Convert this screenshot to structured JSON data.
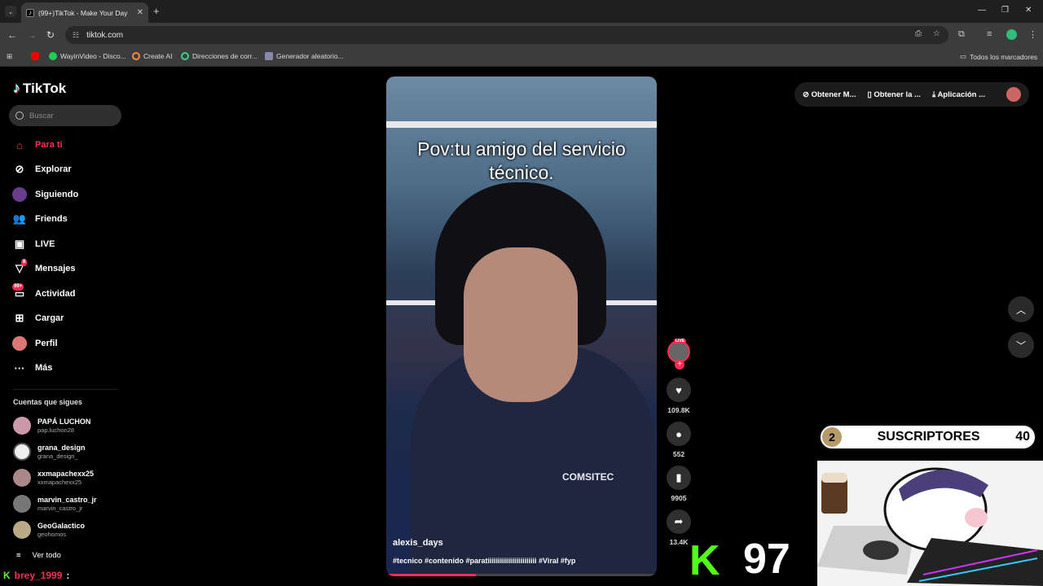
{
  "browser": {
    "tab_title": "(99+)TikTok - Make Your Day",
    "url": "tiktok.com",
    "bookmarks": [
      "WayinVideo - Disco...",
      "Create AI",
      "Direcciones de corr...",
      "Generador aleatorio..."
    ],
    "all_bookmarks": "Todos los marcadores"
  },
  "sidebar": {
    "logo": "TikTok",
    "search_placeholder": "Buscar",
    "menu": [
      {
        "label": "Para ti",
        "icon": "home-icon"
      },
      {
        "label": "Explorar",
        "icon": "compass-icon"
      },
      {
        "label": "Siguiendo",
        "icon": "following-icon"
      },
      {
        "label": "Friends",
        "icon": "friends-icon"
      },
      {
        "label": "LIVE",
        "icon": "live-icon"
      },
      {
        "label": "Mensajes",
        "icon": "messages-icon",
        "badge": "8"
      },
      {
        "label": "Actividad",
        "icon": "activity-icon",
        "badge": "99+"
      },
      {
        "label": "Cargar",
        "icon": "upload-icon"
      },
      {
        "label": "Perfil",
        "icon": "profile-icon"
      },
      {
        "label": "Más",
        "icon": "more-icon"
      }
    ],
    "following_title": "Cuentas que sigues",
    "accounts": [
      {
        "name": "PAPÁ LUCHON",
        "handle": "pap.luchon28"
      },
      {
        "name": "grana_design",
        "handle": "grana_design_"
      },
      {
        "name": "xxmapachexx25",
        "handle": "xxmapachexx25"
      },
      {
        "name": "marvin_castro_jr",
        "handle": "marvin_castro_jr"
      },
      {
        "name": "GeoGalactico",
        "handle": "geohomos"
      }
    ],
    "see_all": "Ver todo"
  },
  "video": {
    "caption": "Pov:tu amigo del servicio técnico.",
    "shirt_logo": "COMSITEC",
    "author": "alexis_days",
    "tags": "#tecnico #contenido #paratiiiiiiiiiiiiiiiiiiiiiiii #Viral #fyp",
    "progress": 0.33,
    "likes": "109.8K",
    "comments": "552",
    "saves": "9905",
    "shares": "13.4K",
    "live_badge": "LIVE"
  },
  "topbar": {
    "btn1": "Obtener M...",
    "btn2": "Obtener la ...",
    "btn3": "Aplicación ..."
  },
  "stream": {
    "chat_user": "brey_1999",
    "chat_sep": ":",
    "kick_logo": "K",
    "viewer_count": "97",
    "sub_left": "2",
    "sub_label": "SUSCRIPTORES",
    "sub_right": "40"
  }
}
